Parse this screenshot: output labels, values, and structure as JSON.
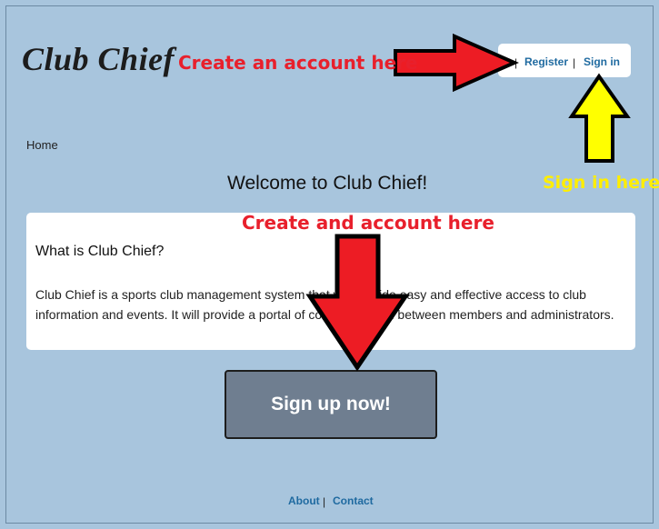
{
  "header": {
    "logo": "Club Chief",
    "nav": {
      "separator": "|",
      "register": "Register",
      "sign_in": "Sign in"
    }
  },
  "breadcrumb": {
    "home": "Home"
  },
  "main": {
    "welcome": "Welcome to Club Chief!",
    "card": {
      "heading": "What is Club Chief?",
      "body": "Club Chief is a sports club management system that will provide easy and effective access to club information and events. It will provide a portal of communication between members and administrators."
    },
    "signup_button": "Sign up now!"
  },
  "footer": {
    "about": "About",
    "separator": "|",
    "contact": "Contact"
  },
  "annotations": {
    "header_note": "Create an account here",
    "signin_note": "Sign in here",
    "card_note": "Create and account here",
    "red_color": "#e8202c",
    "yellow_color": "#ffee00"
  }
}
